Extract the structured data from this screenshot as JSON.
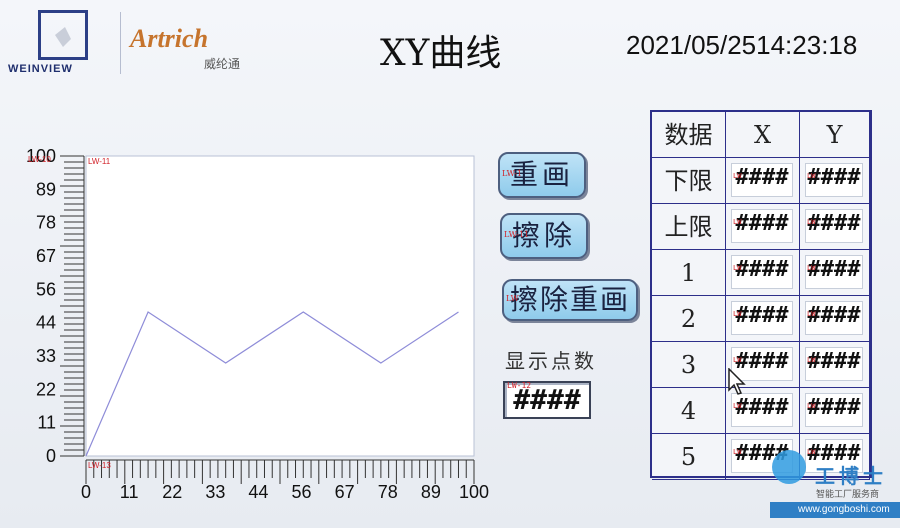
{
  "header": {
    "logo_left_text": "WEINVIEW",
    "logo_right_text": "Artrich",
    "logo_right_cn": "威纶通",
    "title": "XY曲线",
    "datetime": "2021/05/2514:23:18"
  },
  "chart_data": {
    "type": "line",
    "title": "",
    "xlabel": "",
    "ylabel": "",
    "xlim": [
      0,
      100
    ],
    "ylim": [
      0,
      100
    ],
    "x_ticks": [
      "0",
      "11",
      "22",
      "33",
      "44",
      "56",
      "67",
      "78",
      "89",
      "100"
    ],
    "y_ticks": [
      "100",
      "89",
      "78",
      "67",
      "56",
      "44",
      "33",
      "22",
      "11",
      "0"
    ],
    "tags": {
      "top_left": "LW-10",
      "top": "LW-11",
      "bottom": "LW-13"
    },
    "series": [
      {
        "x": [
          0,
          16,
          36,
          56,
          76,
          96
        ],
        "y": [
          0,
          48,
          31,
          48,
          31,
          48
        ]
      }
    ]
  },
  "controls": {
    "redraw": "重画",
    "erase": "擦除",
    "erase_redraw": "擦除重画",
    "points_label": "显示点数",
    "points_value": "####",
    "tag": "LW-12"
  },
  "table": {
    "headers": [
      "数据",
      "X",
      "Y"
    ],
    "rows": [
      {
        "label": "下限",
        "x": "####",
        "y": "####"
      },
      {
        "label": "上限",
        "x": "####",
        "y": "####"
      },
      {
        "label": "1",
        "x": "####",
        "y": "####"
      },
      {
        "label": "2",
        "x": "####",
        "y": "####"
      },
      {
        "label": "3",
        "x": "####",
        "y": "####"
      },
      {
        "label": "4",
        "x": "####",
        "y": "####"
      },
      {
        "label": "5",
        "x": "####",
        "y": "####"
      }
    ],
    "field_tag": "LW"
  },
  "watermark": {
    "cn": "工博士",
    "sub": "智能工厂服务商",
    "url": "www.gongboshi.com"
  },
  "colors": {
    "line": "#8e8cd8",
    "button_fill": "#9fd3ee",
    "grid_border": "#2d2f8a"
  }
}
